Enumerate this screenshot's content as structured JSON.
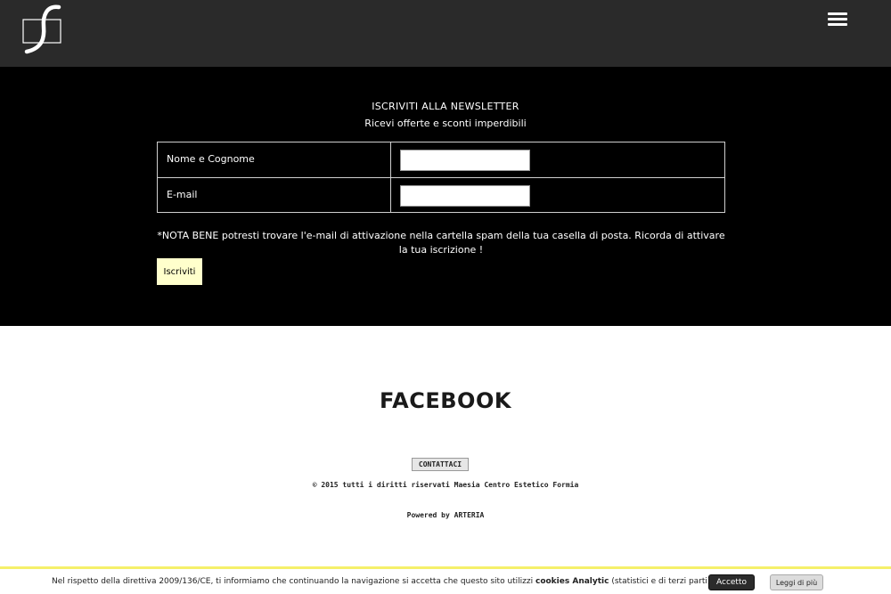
{
  "header": {
    "logo_icon": "script-s-logo",
    "menu_icon": "hamburger-menu-icon"
  },
  "newsletter": {
    "title": "ISCRIVITI ALLA NEWSLETTER",
    "subtitle": "Ricevi offerte e sconti imperdibili",
    "fields": [
      {
        "label": "Nome e Cognome",
        "value": ""
      },
      {
        "label": "E-mail",
        "value": ""
      }
    ],
    "note_prefix": "*NOTA BENE ",
    "note_text": "potresti trovare l'e-mail di attivazione nella cartella spam della tua casella di posta. Ricorda di attivare la tua iscrizione !",
    "submit_label": "Iscriviti"
  },
  "facebook": {
    "heading": "FACEBOOK"
  },
  "footer": {
    "contact_label": "CONTATTACI",
    "copyright": "© 2015 tutti i diritti riservati Maesia Centro Estetico Formia",
    "powered_prefix": "Powered by ",
    "powered_by": "ARTERIA"
  },
  "cookie": {
    "text_before": "Nel rispetto della direttiva 2009/136/CE, ti informiamo che continuando la navigazione si accetta che questo sito utilizzi ",
    "text_bold": "cookies Analytic",
    "text_after": " (statistici e di terzi parti).",
    "accept_label": "Accetto",
    "more_label": "Leggi di più"
  },
  "colors": {
    "header_bg": "#2a2a2a",
    "newsletter_bg": "#000000",
    "submit_bg": "#ffffcc",
    "cookie_border": "#f5f06a"
  }
}
